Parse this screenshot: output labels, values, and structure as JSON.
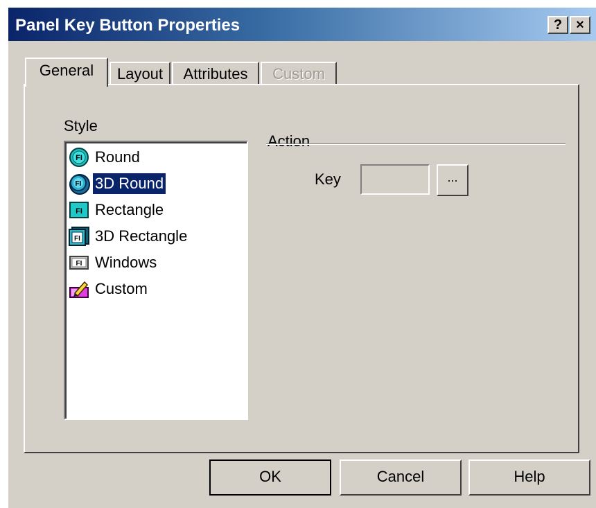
{
  "window": {
    "title": "Panel Key Button Properties"
  },
  "titlebar": {
    "help_label": "?",
    "close_label": "×"
  },
  "tabs": [
    {
      "label": "General",
      "active": true
    },
    {
      "label": "Layout",
      "active": false
    },
    {
      "label": "Attributes",
      "active": false
    },
    {
      "label": "Custom",
      "active": false,
      "disabled": true
    }
  ],
  "style": {
    "label": "Style",
    "selected": "3D Round",
    "items": [
      {
        "label": "Round",
        "icon": "round-style-icon"
      },
      {
        "label": "3D Round",
        "icon": "3d-round-style-icon"
      },
      {
        "label": "Rectangle",
        "icon": "rectangle-style-icon"
      },
      {
        "label": "3D Rectangle",
        "icon": "3d-rectangle-style-icon"
      },
      {
        "label": "Windows",
        "icon": "windows-style-icon"
      },
      {
        "label": "Custom",
        "icon": "custom-style-icon"
      }
    ]
  },
  "action": {
    "label": "Action",
    "key_label": "Key",
    "key_value": "",
    "browse_label": "..."
  },
  "buttons": {
    "ok": "OK",
    "cancel": "Cancel",
    "help": "Help"
  },
  "colors": {
    "selection": "#0a246a",
    "face": "#d4d0c8",
    "title_start": "#0a246a"
  }
}
